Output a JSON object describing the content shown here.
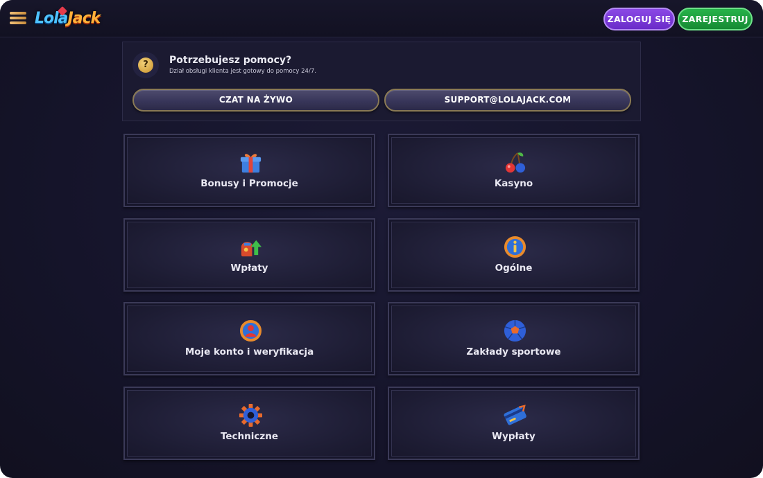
{
  "header": {
    "logo_text_1": "Lola",
    "logo_text_2": "Jack",
    "login_label": "ZALOGUJ SIĘ",
    "register_label": "ZAREJESTRUJ"
  },
  "help": {
    "icon_glyph": "?",
    "title": "Potrzebujesz pomocy?",
    "subtitle": "Dział obsługi klienta jest gotowy do pomocy 24/7.",
    "chat_label": "CZAT NA ŻYWO",
    "email_label": "SUPPORT@LOLAJACK.COM"
  },
  "categories": [
    {
      "label": "Bonusy i Promocje",
      "icon": "gift-icon"
    },
    {
      "label": "Kasyno",
      "icon": "cherries-icon"
    },
    {
      "label": "Wpłaty",
      "icon": "wallet-deposit-icon"
    },
    {
      "label": "Ogólne",
      "icon": "info-icon"
    },
    {
      "label": "Moje konto i weryfikacja",
      "icon": "account-icon"
    },
    {
      "label": "Zakłady sportowe",
      "icon": "football-icon"
    },
    {
      "label": "Techniczne",
      "icon": "gear-icon"
    },
    {
      "label": "Wypłaty",
      "icon": "card-withdraw-icon"
    }
  ],
  "colors": {
    "background": "#15142a",
    "login_purple": "#7a3bd8",
    "register_green": "#1f9e3f",
    "accent_gold": "#c9922c"
  }
}
